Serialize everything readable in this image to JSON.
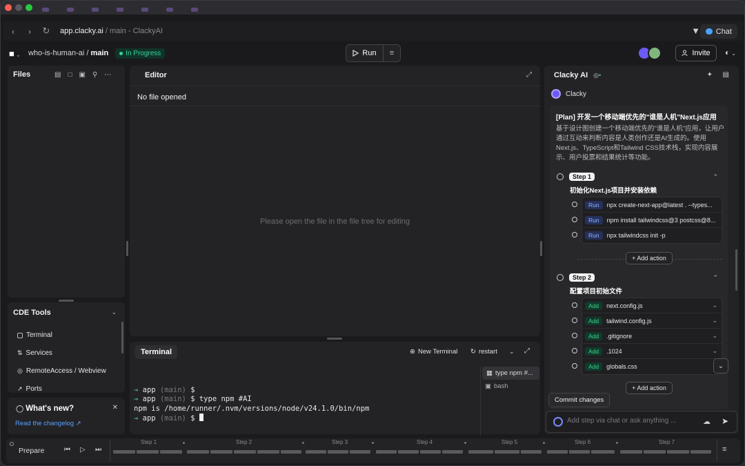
{
  "browser": {
    "url_main": "app.clacky.ai",
    "url_path": " / main - ClackyAI",
    "chat_label": "Chat"
  },
  "header": {
    "project": "who-is-human-ai",
    "separator": " / ",
    "branch": "main",
    "status": "In Progress",
    "run_label": "Run",
    "invite_label": "Invite"
  },
  "files": {
    "title": "Files"
  },
  "cde_tools": {
    "title": "CDE Tools",
    "items": [
      "Terminal",
      "Services",
      "RemoteAccess / Webview",
      "Ports"
    ]
  },
  "whats_new": {
    "title": "What's new?",
    "link": "Read the changelog ↗"
  },
  "editor": {
    "title": "Editor",
    "no_file": "No file opened",
    "empty_hint": "Please open the file in the file tree for editing"
  },
  "terminal": {
    "title": "Terminal",
    "new_terminal": "New Terminal",
    "restart": "restart",
    "lines": [
      {
        "prompt": "→ ",
        "app": "app",
        "branch": " (main)",
        "cmd": " $"
      },
      {
        "prompt": "→ ",
        "app": "app",
        "branch": " (main)",
        "cmd": " $ type npm #AI"
      },
      {
        "plain": "npm is /home/runner/.nvm/versions/node/v24.1.0/bin/npm"
      },
      {
        "prompt": "→ ",
        "app": "app",
        "branch": " (main)",
        "cmd": " $ "
      }
    ],
    "tabs": [
      "type npm #...",
      "bash"
    ]
  },
  "clacky": {
    "title": "Clacky AI",
    "bot_name": "Clacky",
    "plan_title": "[Plan] 开发一个移动端优先的\"谁是人机\"Next.js应用",
    "plan_desc": "基于设计图创建一个移动端优先的\"谁是人机\"应用，让用户通过互动来判断内容是人类创作还是AI生成的。使用Next.js、TypeScript和Tailwind CSS技术栈，实现内容展示、用户投票和结果统计等功能。",
    "steps": [
      {
        "pill": "Step 1",
        "subtitle": "初始化Next.js项目并安装依赖",
        "actions": [
          {
            "tag": "Run",
            "text": "npx create-next-app@latest . --types..."
          },
          {
            "tag": "Run",
            "text": "npm install tailwindcss@3 postcss@8..."
          },
          {
            "tag": "Run",
            "text": "npx tailwindcss init -p"
          }
        ]
      },
      {
        "pill": "Step 2",
        "subtitle": "配置项目初始文件",
        "actions": [
          {
            "tag": "Add",
            "text": "next.config.js"
          },
          {
            "tag": "Add",
            "text": "tailwind.config.js"
          },
          {
            "tag": "Add",
            "text": ".gitignore"
          },
          {
            "tag": "Add",
            "text": ".1024"
          },
          {
            "tag": "Add",
            "text": "globals.css"
          }
        ]
      }
    ],
    "add_action": "+ Add action",
    "commit": "Commit changes",
    "input_placeholder": "Add step via chat or ask anything ..."
  },
  "timeline": {
    "prepare": "Prepare",
    "steps": [
      "Step 1",
      "Step 2",
      "Step 3",
      "Step 4",
      "Step 5",
      "Step 6",
      "Step 7"
    ]
  }
}
